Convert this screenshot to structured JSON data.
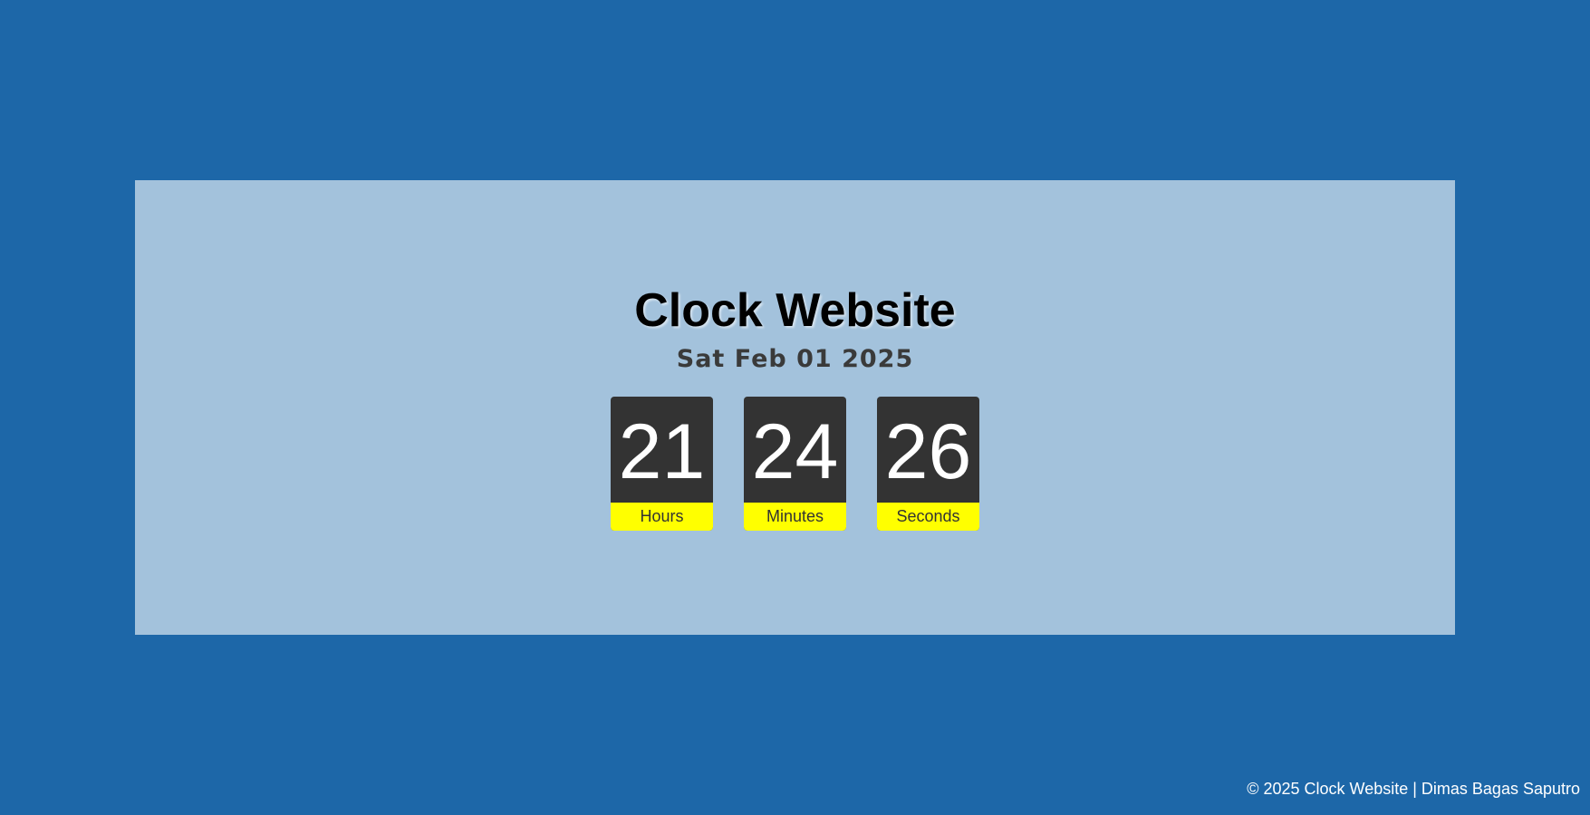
{
  "colors": {
    "page_background": "#1d67a8",
    "panel_background": "#a3c2dc",
    "tile_background": "#333333",
    "label_background": "#ffff00"
  },
  "header": {
    "title": "Clock Website",
    "date": "Sat Feb 01 2025"
  },
  "clock": {
    "units": [
      {
        "value": "21",
        "label": "Hours"
      },
      {
        "value": "24",
        "label": "Minutes"
      },
      {
        "value": "26",
        "label": "Seconds"
      }
    ]
  },
  "footer": {
    "text": "© 2025 Clock Website | Dimas Bagas Saputro"
  }
}
